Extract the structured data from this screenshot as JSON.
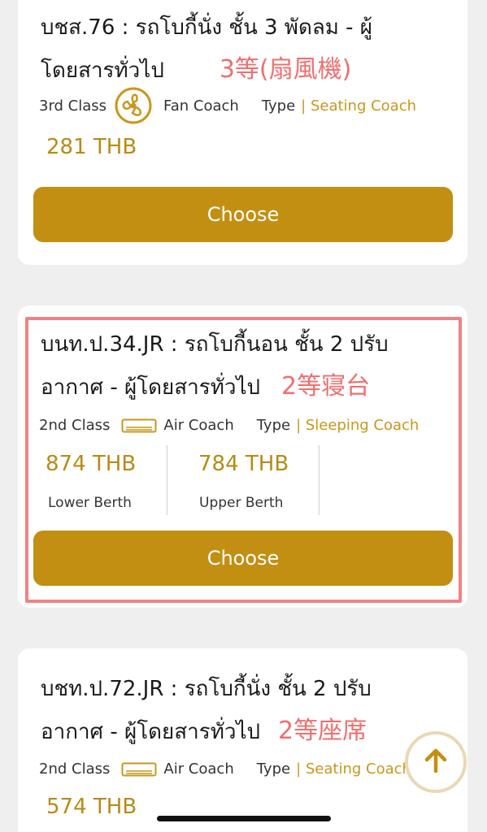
{
  "cards": [
    {
      "title_line1": "บชส.76 : รถโบกี้นั่ง ชั้น 3 พัดลม - ผู้",
      "title_line2": "โดยสารทั่วไป",
      "jp_label": "3等(扇風機)",
      "class_label": "3rd Class",
      "coach_label": "Fan Coach",
      "type_label": "Type",
      "type_value": "| Seating Coach",
      "price": "281 THB",
      "choose_label": "Choose",
      "coach_icon": "fan-icon"
    },
    {
      "title_line1": "บนท.ป.34.JR : รถโบกี้นอน ชั้น 2 ปรับ",
      "title_line2": "อากาศ - ผู้โดยสารทั่วไป",
      "jp_label": "2等寝台",
      "class_label": "2nd Class",
      "coach_label": "Air Coach",
      "type_label": "Type",
      "type_value": "| Sleeping Coach",
      "price_lower": "874 THB",
      "lower_label": "Lower Berth",
      "price_upper": "784 THB",
      "upper_label": "Upper Berth",
      "choose_label": "Choose",
      "coach_icon": "air-conditioner-icon"
    },
    {
      "title_line1": "บชท.ป.72.JR : รถโบกี้นั่ง ชั้น 2 ปรับ",
      "title_line2": "อากาศ - ผู้โดยสารทั่วไป",
      "jp_label": "2等座席",
      "class_label": "2nd Class",
      "coach_label": "Air Coach",
      "type_label": "Type",
      "type_value": "| Seating Coach",
      "price": "574 THB",
      "coach_icon": "air-conditioner-icon"
    }
  ],
  "scroll_top_icon": "arrow-up-icon",
  "colors": {
    "accent": "#c28f13",
    "price": "#b88a16",
    "annotation": "#ef6f6f",
    "highlight_border": "#f28282"
  }
}
